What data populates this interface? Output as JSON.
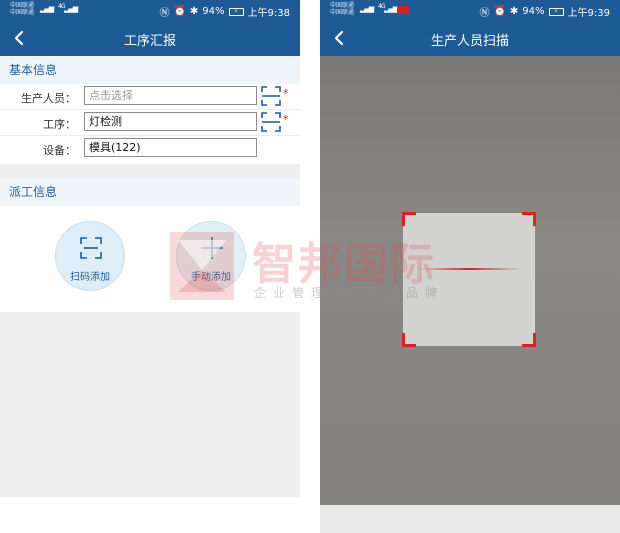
{
  "left_screen": {
    "status": {
      "carrier_1": "中国联通",
      "carrier_2": "中国联通",
      "signal": "4G",
      "battery": "94%",
      "time": "上午9:38",
      "nfc_icon": "nfc-icon",
      "alarm_icon": "alarm-icon",
      "bluetooth_icon": "bluetooth-icon"
    },
    "title": "工序汇报",
    "basic_info": {
      "header": "基本信息",
      "fields": [
        {
          "label": "生产人员：",
          "placeholder": "点击选择",
          "value": "",
          "required": "*"
        },
        {
          "label": "工序：",
          "value": "灯检测",
          "required": "*"
        },
        {
          "label": "设备：",
          "value": "模具(122)"
        }
      ]
    },
    "dispatch_info": {
      "header": "派工信息",
      "scan_add_label": "扫码添加",
      "manual_add_label": "手动添加"
    }
  },
  "right_screen": {
    "status": {
      "carrier_1": "中国联通",
      "carrier_2": "中国联通",
      "signal": "4G",
      "battery": "94%",
      "time": "上午9:39"
    },
    "title": "生产人员扫描"
  },
  "watermark": {
    "title": "智邦国际",
    "subtitle": "企业管理软件专业品牌"
  },
  "colors": {
    "header_blue": "#1e5b96",
    "section_bg": "#eef6fc",
    "required_red": "#e02020",
    "scan_corner_red": "#e02020",
    "button_circle": "#ddeef9"
  }
}
